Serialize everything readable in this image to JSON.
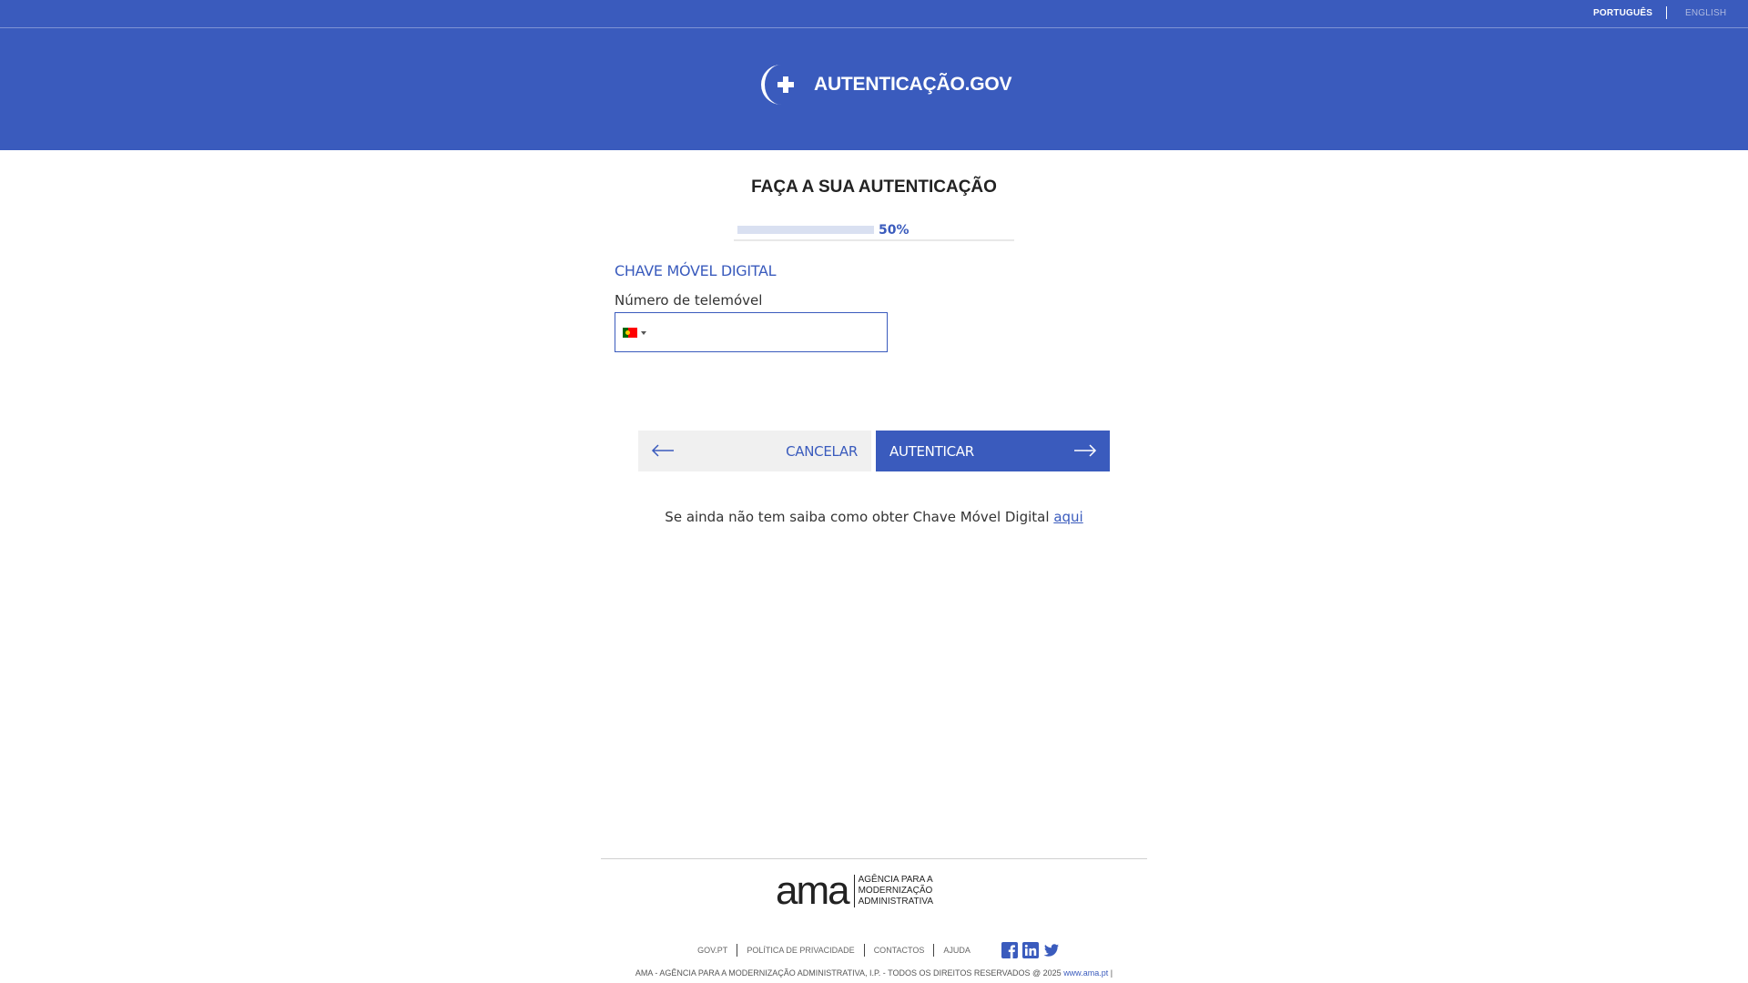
{
  "languages": {
    "pt": "PORTUGUÊS",
    "en": "ENGLISH"
  },
  "header": {
    "brand": "AUTENTICAÇÃO.GOV"
  },
  "main": {
    "title": "FAÇA A SUA AUTENTICAÇÃO",
    "progress": {
      "value": 0.5,
      "label": "50%"
    },
    "section_title": "CHAVE MÓVEL DIGITAL",
    "phone_label": "Número de telemóvel",
    "phone_value": "",
    "country_flag": "portugal-flag",
    "cancel_label": "CANCELAR",
    "auth_label": "AUTENTICAR",
    "help_text": "Se ainda não tem saiba como obter Chave Móvel Digital",
    "help_link": "aqui"
  },
  "footer": {
    "logo_mark": "ama",
    "logo_name_1": "AGÊNCIA PARA A",
    "logo_name_2": "MODERNIZAÇÃO",
    "logo_name_3": "ADMINISTRATIVA",
    "links": [
      "GOV.PT",
      "POLÍTICA DE PRIVACIDADE",
      "CONTACTOS",
      "AJUDA"
    ],
    "social": [
      "facebook-icon",
      "linkedin-icon",
      "twitter-icon"
    ],
    "copyright": "AMA - AGÊNCIA PARA A MODERNIZAÇÃO ADMINISTRATIVA, I.P. - TODOS OS DIREITOS RESERVADOS @ 2025",
    "copyright_link": "www.ama.pt",
    "copyright_tail": "|"
  },
  "colors": {
    "brand": "#3a5bbd",
    "cancel_bg": "#f0f0f0",
    "progress_bg": "#d9e0f1"
  }
}
